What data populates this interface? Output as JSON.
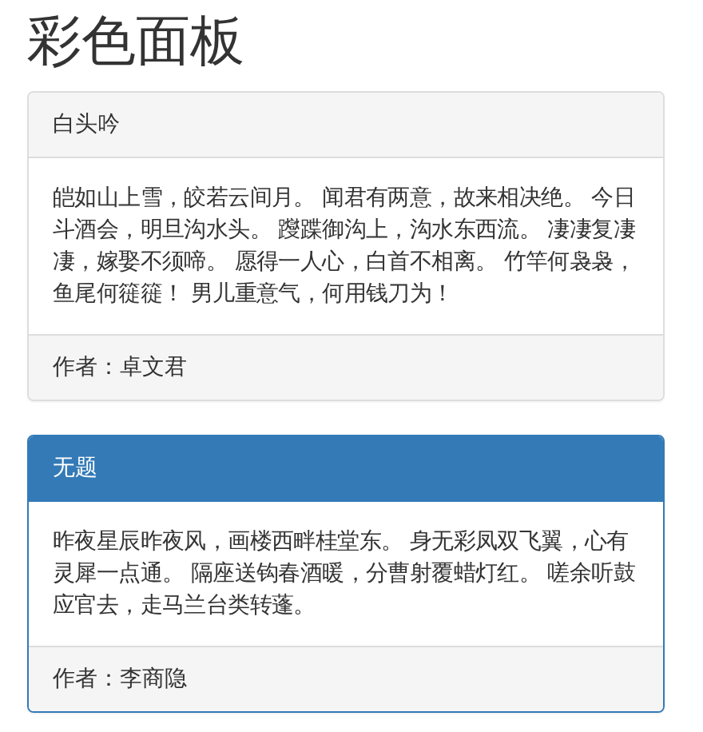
{
  "title": "彩色面板",
  "panels": [
    {
      "kind": "default",
      "heading": "白头吟",
      "body": "皑如山上雪，皎若云间月。 闻君有两意，故来相决绝。 今日斗酒会，明旦沟水头。 躞蹀御沟上，沟水东西流。 凄凄复凄凄，嫁娶不须啼。 愿得一人心，白首不相离。 竹竿何袅袅，鱼尾何簁簁！ 男儿重意气，何用钱刀为！",
      "footer": "作者：卓文君"
    },
    {
      "kind": "primary",
      "heading": "无题",
      "body": "昨夜星辰昨夜风，画楼西畔桂堂东。 身无彩凤双飞翼，心有灵犀一点通。 隔座送钩春酒暖，分曹射覆蜡灯红。 嗟余听鼓应官去，走马兰台类转蓬。",
      "footer": "作者：李商隐"
    }
  ]
}
